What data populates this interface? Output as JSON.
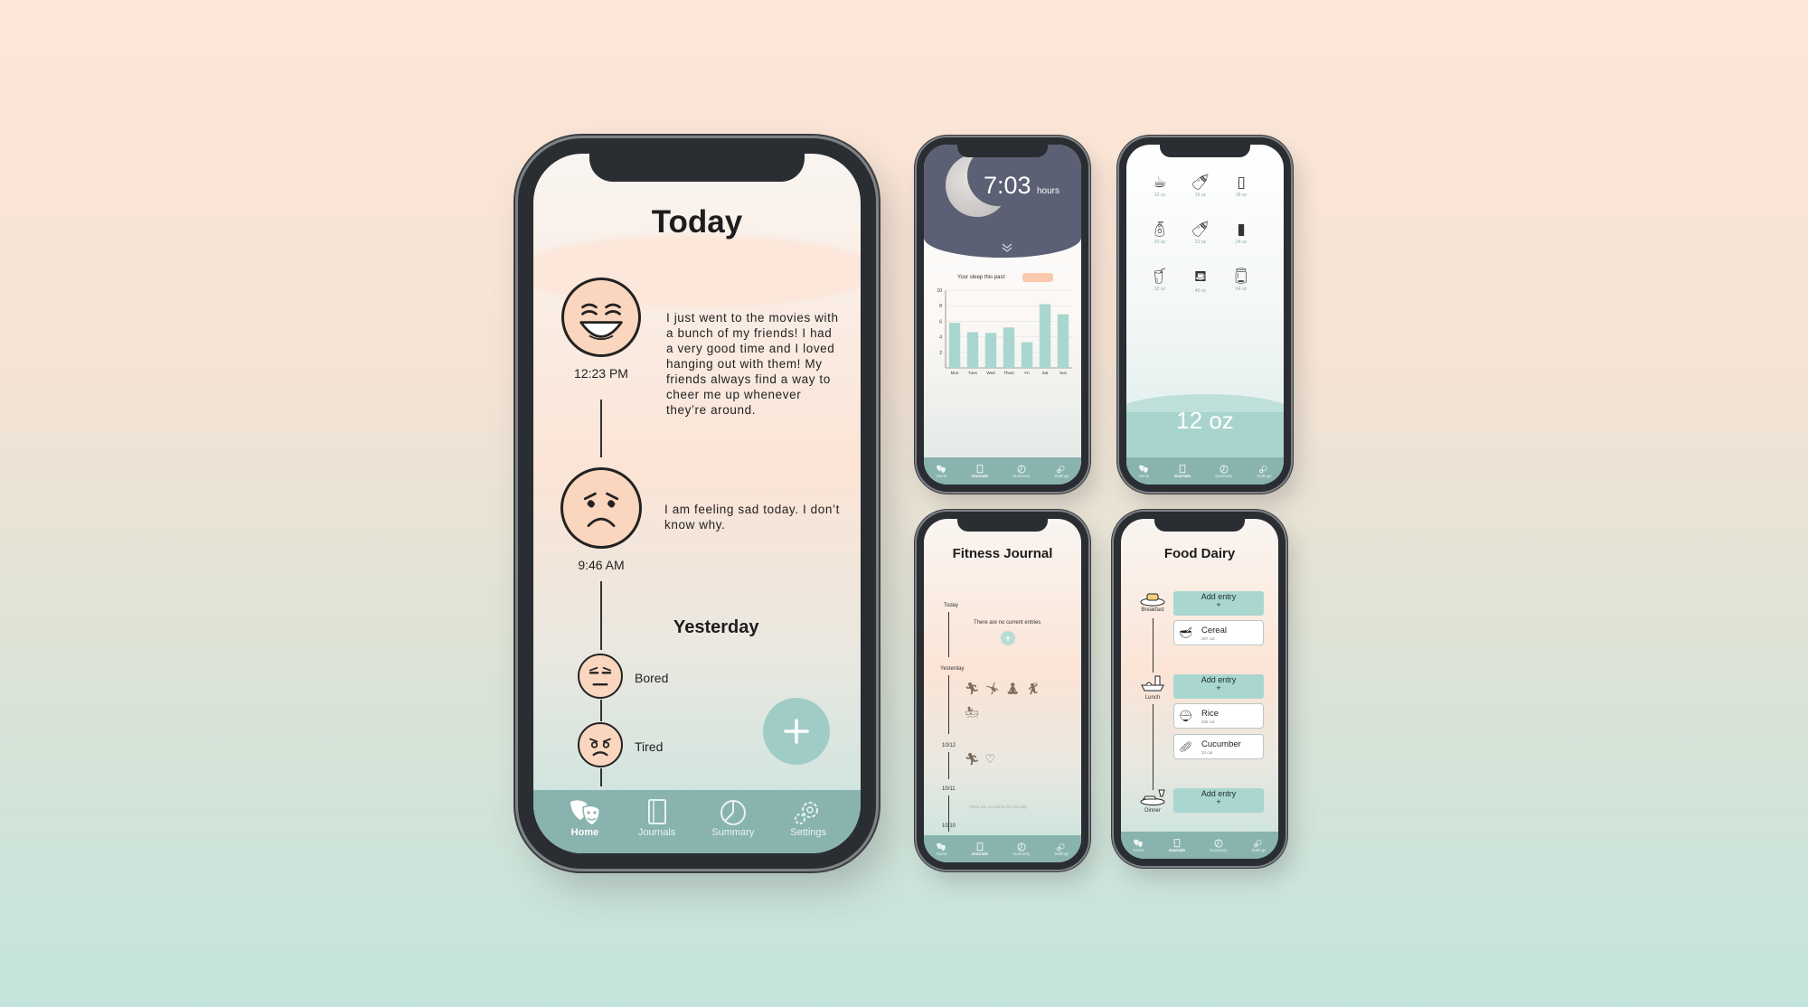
{
  "colors": {
    "accent": "#89b3ae",
    "face": "#fbd6be",
    "fab": "#a0ccc8",
    "bar": "#a9d6cf",
    "night": "#5b6074",
    "pill": "#fbc9ae"
  },
  "nav": [
    {
      "label": "Home",
      "icon": "masks-icon"
    },
    {
      "label": "Journals",
      "icon": "journal-icon"
    },
    {
      "label": "Summary",
      "icon": "pie-icon"
    },
    {
      "label": "Settings",
      "icon": "gear-icon"
    }
  ],
  "main": {
    "title": "Today",
    "entries": [
      {
        "time": "12:23 PM",
        "mood": "happy",
        "text": "I just went to the movies with a bunch of my friends! I had a very good time and I loved hanging out with them! My friends always find a way to cheer me up whenever they’re around."
      },
      {
        "time": "9:46 AM",
        "mood": "sad",
        "text": "I am feeling sad today. I don’t know why."
      }
    ],
    "yesterday_title": "Yesterday",
    "yesterday": [
      {
        "label": "Bored"
      },
      {
        "label": "Tired"
      }
    ],
    "fab_icon": "plus-icon"
  },
  "sleep": {
    "time": "7:03",
    "unit": "hours",
    "past_label": "Your sleep this past:",
    "chart_data": {
      "type": "bar",
      "categories": [
        "Mon",
        "Tues",
        "Wed",
        "Thurs",
        "Fri",
        "Sat",
        "Sun"
      ],
      "values": [
        5.8,
        4.6,
        4.5,
        5.2,
        3.3,
        8.2,
        6.9
      ],
      "yticks": [
        2,
        4,
        6,
        8,
        10
      ],
      "ylim": [
        0,
        10
      ]
    }
  },
  "water": {
    "items": [
      {
        "icon": "mug-icon",
        "label": "12 oz"
      },
      {
        "icon": "bottle-icon",
        "label": "16 oz"
      },
      {
        "icon": "tall-bottle-icon",
        "label": "18 oz"
      },
      {
        "icon": "soda-bottle-icon",
        "label": "20 oz"
      },
      {
        "icon": "bottle-icon",
        "label": "21 oz"
      },
      {
        "icon": "flask-icon",
        "label": "24 oz"
      },
      {
        "icon": "glass-icon",
        "label": "32 oz"
      },
      {
        "icon": "jug-icon",
        "label": "40 oz"
      },
      {
        "icon": "big-jug-icon",
        "label": "64 oz"
      }
    ],
    "total": "12 oz"
  },
  "fitness": {
    "title": "Fitness Journal",
    "today": "Today",
    "no_entries": "There are no current entries",
    "yesterday": "Yesterday",
    "d1": "10/12",
    "d2": "10/11",
    "d2_note": "There are no entries for this day",
    "d3": "10/10"
  },
  "food": {
    "title": "Food Dairy",
    "meals": [
      {
        "label": "Breakfast",
        "add": "Add entry",
        "items": [
          {
            "name": "Cereal",
            "cal": "307 cal"
          }
        ]
      },
      {
        "label": "Lunch",
        "add": "Add entry",
        "items": [
          {
            "name": "Rice",
            "cal": "206 cal"
          },
          {
            "name": "Cucumber",
            "cal": "24 cal"
          }
        ]
      },
      {
        "label": "Dinner",
        "add": "Add entry",
        "items": []
      }
    ]
  }
}
